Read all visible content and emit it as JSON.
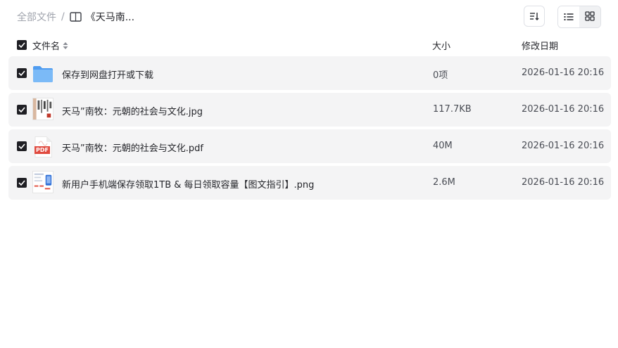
{
  "breadcrumb": {
    "root": "全部文件",
    "separator": "/",
    "current": "《天马南..."
  },
  "toolbar": {
    "sort_icon": "sort-icon",
    "list_view_icon": "list-view-icon",
    "grid_view_icon": "grid-view-icon"
  },
  "header": {
    "name": "文件名",
    "size": "大小",
    "date": "修改日期"
  },
  "files": [
    {
      "name": "保存到网盘打开或下载",
      "size": "0项",
      "date": "2026-01-16 20:16",
      "icon": "folder-icon"
    },
    {
      "name": "天马”南牧：元朝的社会与文化.jpg",
      "size": "117.7KB",
      "date": "2026-01-16 20:16",
      "icon": "image-thumbnail"
    },
    {
      "name": "天马”南牧：元朝的社会与文化.pdf",
      "size": "40M",
      "date": "2026-01-16 20:16",
      "icon": "pdf-icon",
      "icon_label": "PDF"
    },
    {
      "name": "新用户手机端保存领取1TB & 每日领取容量【图文指引】.png",
      "size": "2.6M",
      "date": "2026-01-16 20:16",
      "icon": "image-thumbnail"
    }
  ],
  "colors": {
    "row_bg": "#f4f4f5",
    "checkbox": "#1f1f24",
    "folder": "#5ea8f3",
    "pdf": "#e04a3f",
    "muted_text": "#a0a4ad"
  }
}
